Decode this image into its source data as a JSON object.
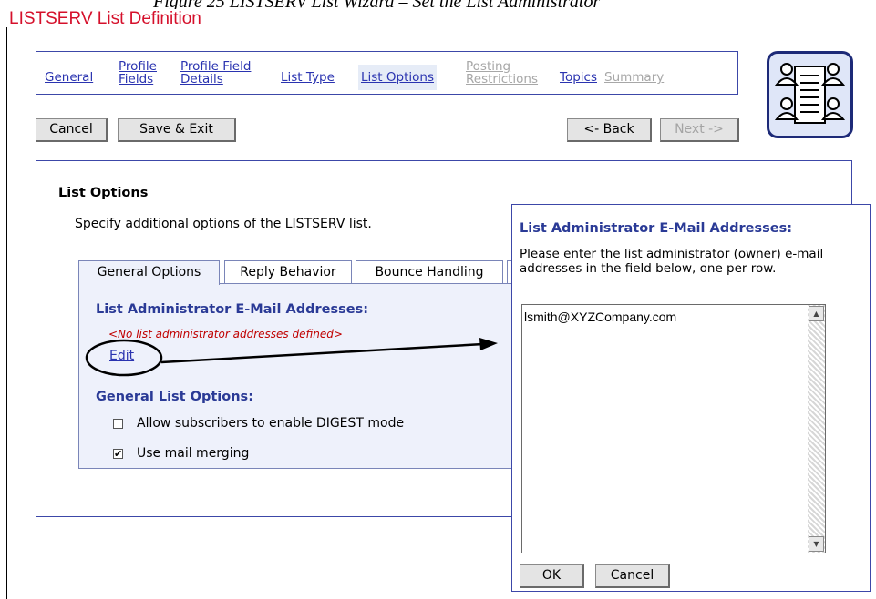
{
  "caption": "Figure 25 LISTSERV List Wizard – Set the List Administrator",
  "title": "LISTSERV List Definition",
  "wizard_steps": [
    {
      "line1": "General",
      "line2": ""
    },
    {
      "line1": "Profile",
      "line2": "Fields"
    },
    {
      "line1": "Profile Field",
      "line2": "Details"
    },
    {
      "line1": "List Type",
      "line2": ""
    },
    {
      "line1": "List Options",
      "line2": ""
    },
    {
      "line1": "Posting",
      "line2": "Restrictions"
    },
    {
      "line1": "Topics",
      "line2": ""
    },
    {
      "line1": "Summary",
      "line2": ""
    }
  ],
  "toolbar": {
    "cancel": "Cancel",
    "save_exit": "Save & Exit",
    "back": "<- Back",
    "next": "Next ->"
  },
  "panel": {
    "heading": "List Options",
    "description": "Specify additional options of the LISTSERV list.",
    "tabs": [
      "General Options",
      "Reply Behavior",
      "Bounce Handling"
    ],
    "admin_heading": "List Administrator E-Mail Addresses:",
    "no_admin": "<No list administrator addresses defined>",
    "edit_link": "Edit",
    "general_heading": "General List Options:",
    "options": [
      {
        "label": "Allow subscribers to enable DIGEST mode",
        "checked": false
      },
      {
        "label": "Use mail merging",
        "checked": true
      }
    ]
  },
  "dialog": {
    "heading": "List Administrator E-Mail Addresses:",
    "instructions": "Please enter the list administrator (owner) e-mail addresses in the field below, one per row.",
    "textarea_value": "lsmith@XYZCompany.com",
    "ok": "OK",
    "cancel": "Cancel"
  },
  "colors": {
    "title": "#d5102b",
    "link": "#2a33b0",
    "heading": "#2a3a96",
    "error": "#c00000"
  }
}
